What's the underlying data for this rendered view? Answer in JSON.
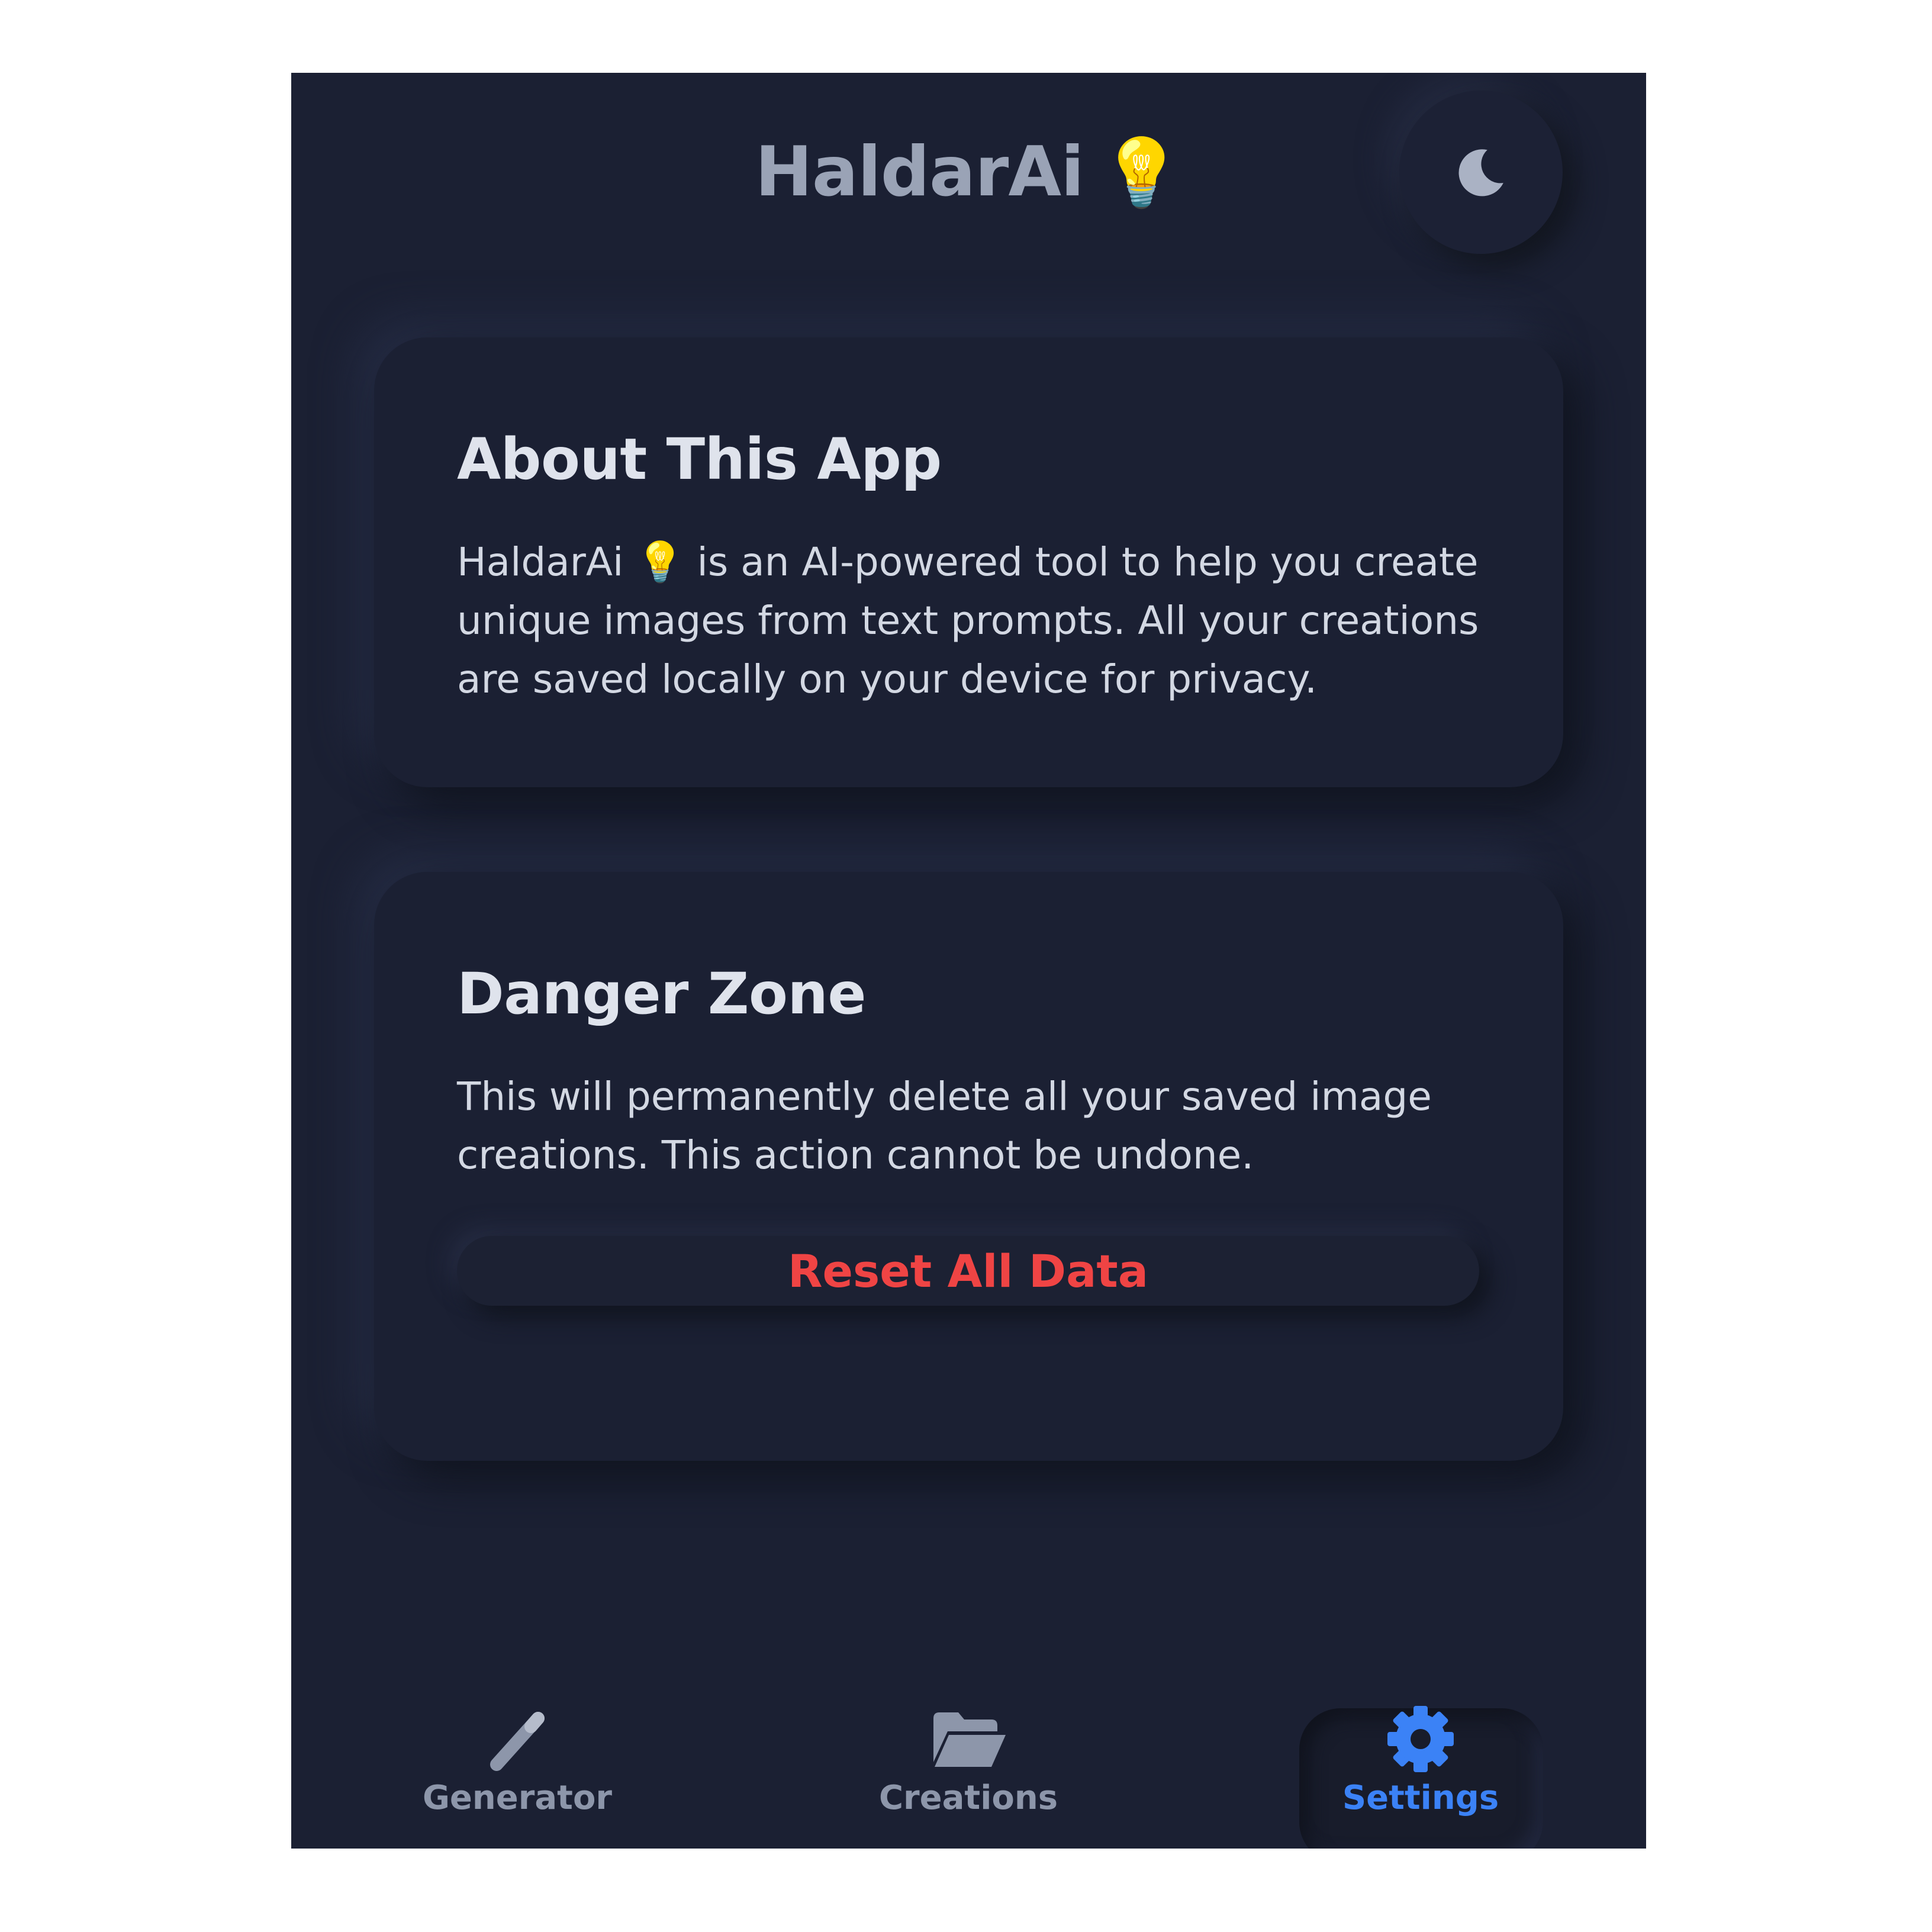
{
  "header": {
    "title": "HaldarAi",
    "title_emoji": "💡",
    "theme_toggle_icon": "moon-icon"
  },
  "about": {
    "heading": "About This App",
    "body": "HaldarAi 💡 is an AI-powered tool to help you create unique images from text prompts. All your creations are saved locally on your device for privacy."
  },
  "danger": {
    "heading": "Danger Zone",
    "body": "This will permanently delete all your saved image creations. This action cannot be undone.",
    "reset_label": "Reset All Data"
  },
  "nav": {
    "items": [
      {
        "label": "Generator",
        "icon": "magic-wand-icon",
        "active": false
      },
      {
        "label": "Creations",
        "icon": "folder-open-icon",
        "active": false
      },
      {
        "label": "Settings",
        "icon": "gear-icon",
        "active": true
      }
    ]
  },
  "colors": {
    "background": "#1b2033",
    "accent": "#3b82f6",
    "danger": "#ef4444",
    "muted": "#8d96aa"
  }
}
